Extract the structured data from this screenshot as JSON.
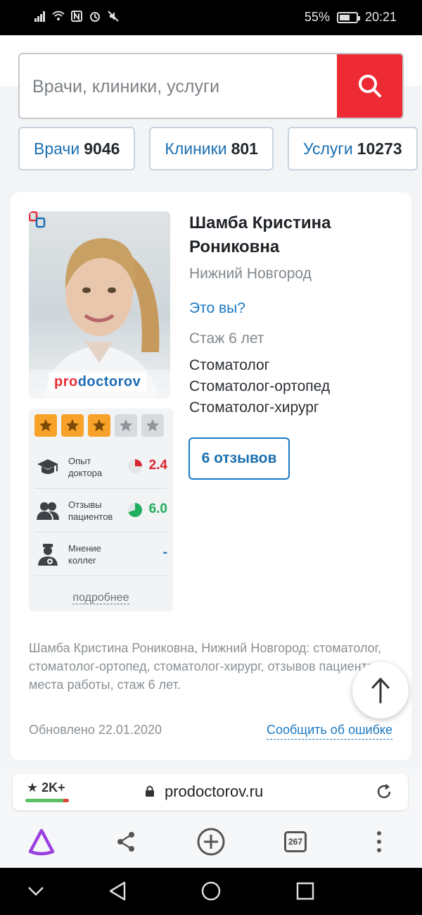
{
  "status_bar": {
    "battery_percent": "55%",
    "time": "20:21"
  },
  "search": {
    "placeholder": "Врачи, клиники, услуги"
  },
  "chips": [
    {
      "label": "Врачи",
      "count": "9046"
    },
    {
      "label": "Клиники",
      "count": "801"
    },
    {
      "label": "Услуги",
      "count": "10273"
    }
  ],
  "doctor": {
    "name": "Шамба Кристина Рониковна",
    "city": "Нижний Новгород",
    "its_you": "Это вы?",
    "experience": "Стаж 6 лет",
    "specialties": [
      "Стоматолог",
      "Стоматолог-ортопед",
      "Стоматолог-хирург"
    ],
    "reviews_button": "6 отзывов",
    "photo_watermark_pro": "pro",
    "photo_watermark_rest": "doctorov"
  },
  "rating": {
    "stars_filled": 3,
    "stars_total": 5,
    "rows": [
      {
        "label": "Опыт доктора",
        "value": "2.4",
        "color": "#d8262e",
        "fraction": 0.25
      },
      {
        "label": "Отзывы пациентов",
        "value": "6.0",
        "color": "#1fae5b",
        "fraction": 0.7
      },
      {
        "label": "Мнение коллег",
        "value": "-",
        "color": "#1b78c2",
        "fraction": 0
      }
    ],
    "more_link": "подробнее"
  },
  "footer": {
    "description": "Шамба Кристина Рониковна, Нижний Новгород: стоматолог, стоматолог-ортопед, стоматолог-хирург, отзывов пациентов, места работы, стаж 6 лет.",
    "updated": "Обновлено 22.01.2020",
    "report_error": "Сообщить об ошибке"
  },
  "browser": {
    "site_rating": "2K+",
    "domain": "prodoctorov.ru",
    "tabs_count": "267"
  },
  "colors": {
    "accent_blue": "#1b78c2",
    "search_red": "#ee2b35",
    "star_orange": "#f8a22a",
    "assistant_purple": "#9b3fe0"
  }
}
